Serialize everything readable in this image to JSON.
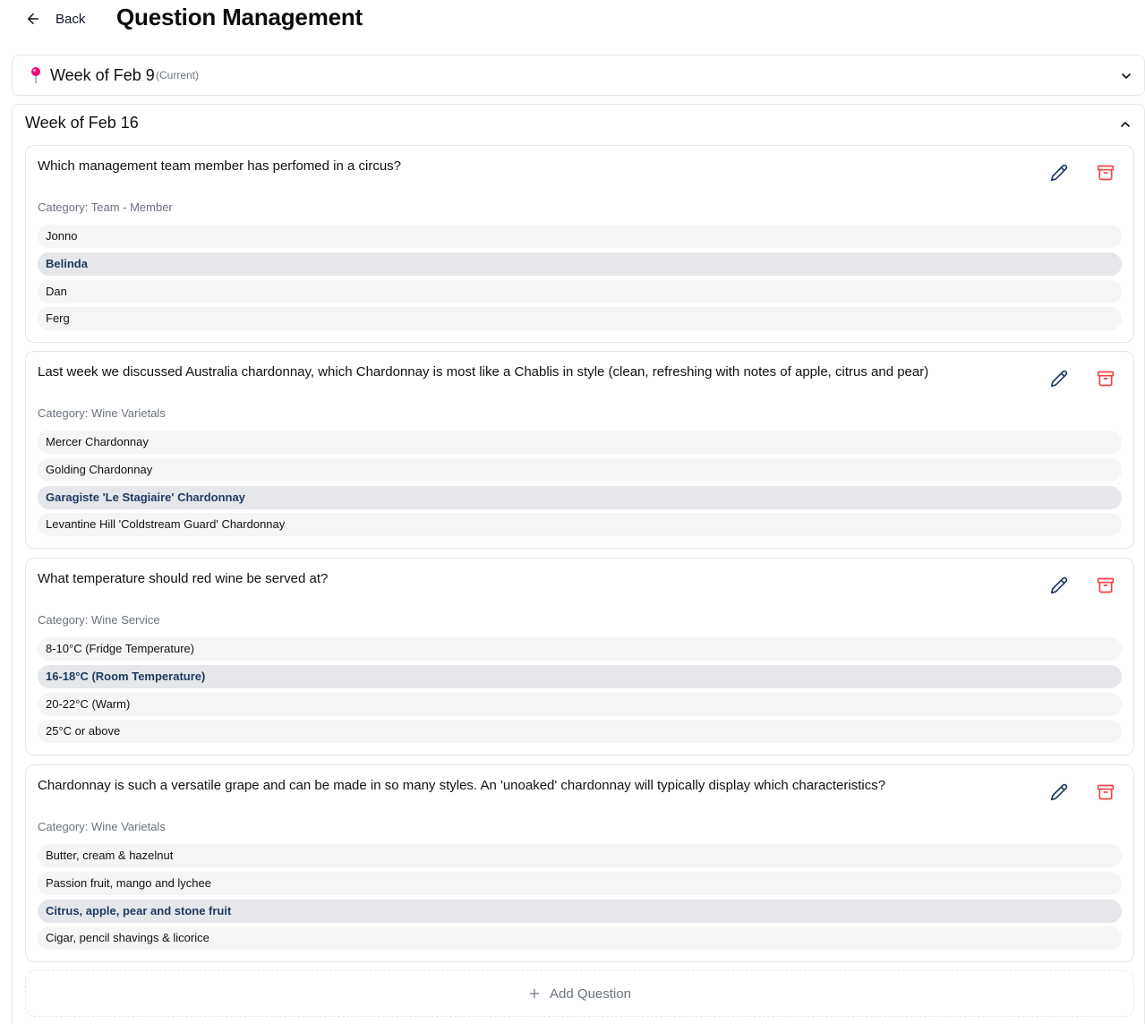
{
  "header": {
    "back_label": "Back",
    "title": "Question Management"
  },
  "weeks": [
    {
      "title": "Week of Feb 9",
      "tag": "(Current)",
      "expanded": false,
      "pin_color": "#ec0c7a"
    },
    {
      "title": "Week of Feb 16",
      "expanded": true,
      "questions": [
        {
          "text": "Which management team member has perfomed in a circus?",
          "category": "Category: Team - Member",
          "options": [
            {
              "label": "Jonno",
              "correct": false
            },
            {
              "label": "Belinda",
              "correct": true
            },
            {
              "label": "Dan",
              "correct": false
            },
            {
              "label": "Ferg",
              "correct": false
            }
          ]
        },
        {
          "text": "Last week we discussed Australia chardonnay, which Chardonnay is most like a Chablis in style (clean, refreshing with notes of apple, citrus and pear)",
          "category": "Category: Wine Varietals",
          "options": [
            {
              "label": "Mercer Chardonnay",
              "correct": false
            },
            {
              "label": "Golding Chardonnay",
              "correct": false
            },
            {
              "label": "Garagiste 'Le Stagiaire' Chardonnay",
              "correct": true
            },
            {
              "label": "Levantine Hill 'Coldstream Guard' Chardonnay",
              "correct": false
            }
          ]
        },
        {
          "text": "What temperature should red wine be served at?",
          "category": "Category: Wine Service",
          "options": [
            {
              "label": "8-10°C (Fridge Temperature)",
              "correct": false
            },
            {
              "label": "16-18°C (Room Temperature)",
              "correct": true
            },
            {
              "label": "20-22°C (Warm)",
              "correct": false
            },
            {
              "label": "25°C or above",
              "correct": false
            }
          ]
        },
        {
          "text": "Chardonnay is such a versatile grape and can be made in so many styles. An 'unoaked' chardonnay will typically display which characteristics?",
          "category": "Category: Wine Varietals",
          "options": [
            {
              "label": "Butter, cream & hazelnut",
              "correct": false
            },
            {
              "label": "Passion fruit, mango and lychee",
              "correct": false
            },
            {
              "label": "Citrus, apple, pear and stone fruit",
              "correct": true
            },
            {
              "label": "Cigar, pencil shavings & licorice",
              "correct": false
            }
          ]
        }
      ],
      "add_label": "Add Question"
    }
  ],
  "colors": {
    "edit_icon": "#1e3a5f",
    "archive_icon": "#ef4444",
    "correct_bg": "#e5e7eb",
    "option_bg": "#f5f5f4"
  }
}
